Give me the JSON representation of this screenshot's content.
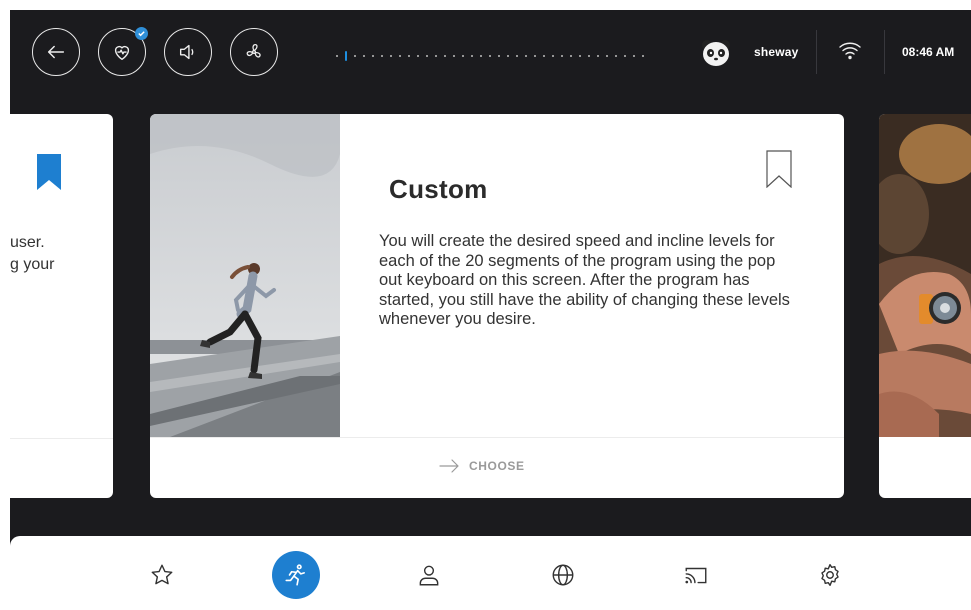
{
  "topbar": {
    "buttons": [
      {
        "name": "back",
        "icon": "arrow-left-icon"
      },
      {
        "name": "heart-rate",
        "icon": "heart-rate-icon",
        "badge": "check-icon"
      },
      {
        "name": "volume",
        "icon": "speaker-icon"
      },
      {
        "name": "fan",
        "icon": "fan-icon"
      }
    ],
    "page_indicator": {
      "count": 35,
      "active_index": 1
    },
    "username": "sheway",
    "time": "08:46 AM",
    "wifi_icon": "wifi-icon"
  },
  "carousel": {
    "left_card": {
      "text_lines": [
        "user.",
        "g your"
      ],
      "bookmark": "bookmark-filled-icon"
    },
    "main_card": {
      "title": "Custom",
      "description": "You will create the desired speed and incline levels for each of the 20 segments of the program using the pop out keyboard on this screen. After the program has started, you still have the ability of changing these levels whenever you desire.",
      "action_label": "CHOOSE",
      "bookmark": "bookmark-outline-icon"
    }
  },
  "bottom_nav": [
    {
      "name": "favorites",
      "icon": "star-icon"
    },
    {
      "name": "run",
      "icon": "runner-icon",
      "active": true
    },
    {
      "name": "profile",
      "icon": "user-icon"
    },
    {
      "name": "web",
      "icon": "globe-icon"
    },
    {
      "name": "cast",
      "icon": "cast-icon"
    },
    {
      "name": "settings",
      "icon": "gear-icon"
    }
  ],
  "colors": {
    "accent": "#1e7fd0",
    "background": "#1b1b1e",
    "badge": "#2f8fd8"
  }
}
